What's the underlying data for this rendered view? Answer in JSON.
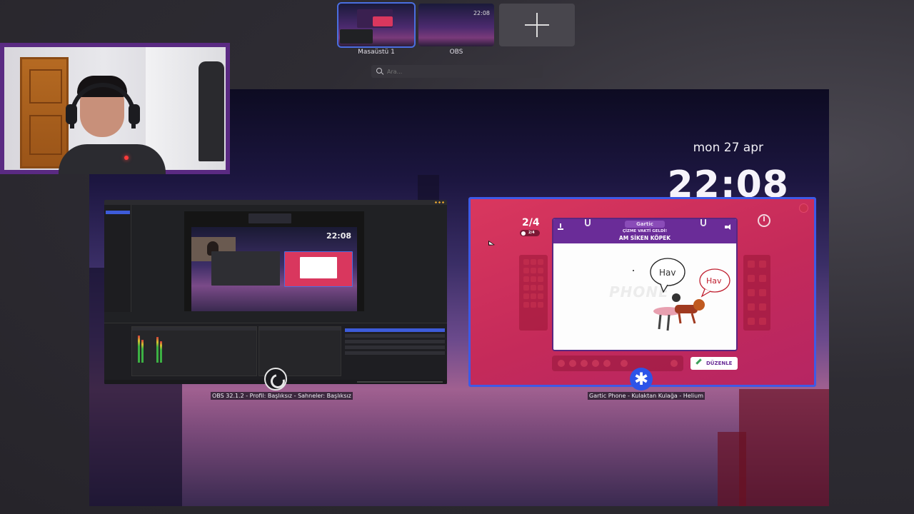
{
  "workspaces": [
    {
      "label": "Masaüstü 1",
      "active": true
    },
    {
      "label": "OBS",
      "active": false,
      "thumb_time": "22:08"
    }
  ],
  "search": {
    "placeholder": "Ara..."
  },
  "desktop": {
    "date": "mon 27 apr",
    "time": "22:08"
  },
  "windows": {
    "obs": {
      "label": "OBS 32.1.2 - Profil: Başlıksız - Sahneler: Başlıksız",
      "preview_time": "22:08"
    },
    "gartic": {
      "label": "Gartic Phone - Kulaktan Kulağa - Helium",
      "round": "2/4",
      "round_badge": "2/4",
      "logo": "Gartic",
      "subtitle": "ÇİZME VAKTİ GELDİ!",
      "prompt": "AM SİKEN KÖPEK",
      "watermark": "PHONE",
      "bubble1": "Hav",
      "bubble2": "Hav",
      "edit_button": "DÜZENLE"
    }
  },
  "colors": {
    "accent": "#3f5ae6",
    "gartic_bg": "#c42a5a",
    "gartic_header": "#6a2c98"
  }
}
